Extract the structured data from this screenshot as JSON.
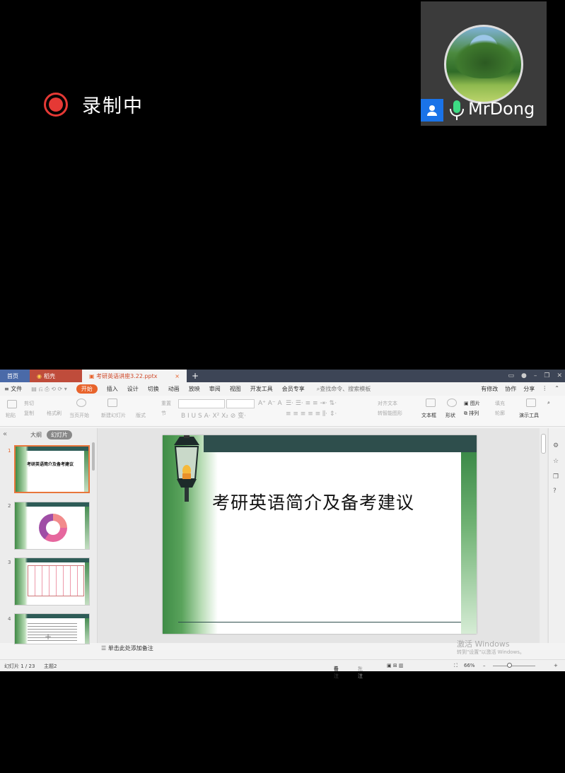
{
  "recording": {
    "label": "录制中"
  },
  "participant": {
    "name": "MrDong"
  },
  "tabs": {
    "home": "首页",
    "daoke": "稻壳",
    "doc": "考研英语讲座3.22.pptx",
    "close": "×",
    "plus": "+"
  },
  "menu": {
    "file": "≡ 文件",
    "items": [
      "开始",
      "插入",
      "设计",
      "切换",
      "动画",
      "放映",
      "审阅",
      "视图",
      "开发工具",
      "会员专享"
    ],
    "search": "查找命令、搜索模板",
    "right": [
      "有修改",
      "协作",
      "分享"
    ]
  },
  "ribbon": {
    "paste": "粘贴",
    "cut": "剪切",
    "copy": "复制",
    "format": "格式刷",
    "play": "当页开始",
    "new_slide": "新建幻灯片",
    "layout": "版式",
    "reset": "重置",
    "section": "节",
    "align_text": "对齐文本",
    "smartart": "转智能图形",
    "textbox": "文本框",
    "shape": "形状",
    "picture": "图片",
    "arrange": "排列",
    "fill": "填充",
    "outline": "轮廓",
    "present_tool": "演示工具"
  },
  "panel": {
    "outline": "大纲",
    "slides": "幻灯片",
    "collapse": "«",
    "add": "+"
  },
  "thumbnails": [
    {
      "num": "1",
      "text": "考研英语简介及备考建议"
    },
    {
      "num": "2",
      "text": ""
    },
    {
      "num": "3",
      "text": ""
    },
    {
      "num": "4",
      "text": ""
    }
  ],
  "slide": {
    "title": "考研英语简介及备考建议"
  },
  "notes": {
    "placeholder": "单击此处添加备注"
  },
  "watermark": {
    "line1": "激活 Windows",
    "line2": "转到\"设置\"以激活 Windows。"
  },
  "status": {
    "slide_count": "幻灯片 1 / 23",
    "theme": "主题2",
    "notes": "备注",
    "comments": "批注",
    "zoom": "66%"
  }
}
